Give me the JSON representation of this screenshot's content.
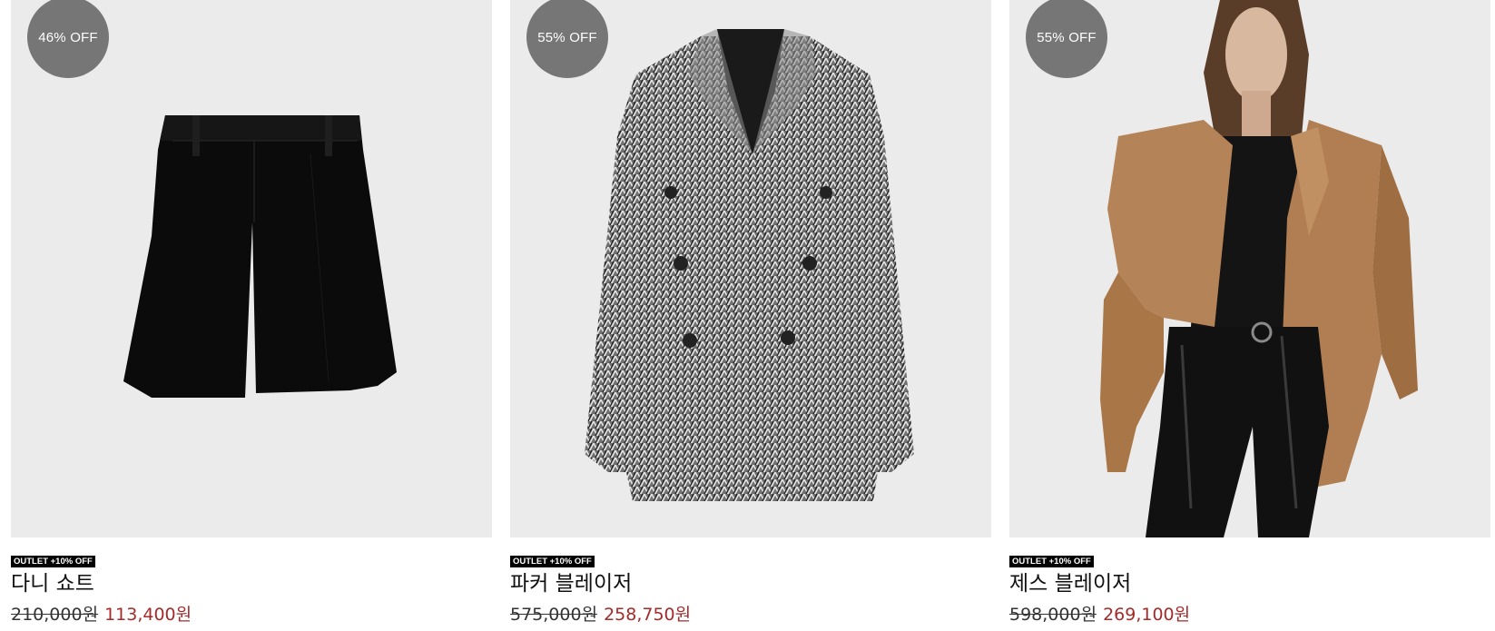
{
  "products": [
    {
      "badge": "46% OFF",
      "tag": "OUTLET +10% OFF",
      "name": "다니 쇼트",
      "original_price": "210,000원",
      "sale_price": "113,400원",
      "image": "black-shorts-icon"
    },
    {
      "badge": "55% OFF",
      "tag": "OUTLET +10% OFF",
      "name": "파커 블레이저",
      "original_price": "575,000원",
      "sale_price": "258,750원",
      "image": "herringbone-blazer-icon"
    },
    {
      "badge": "55% OFF",
      "tag": "OUTLET +10% OFF",
      "name": "제스 블레이저",
      "original_price": "598,000원",
      "sale_price": "269,100원",
      "image": "model-camel-blazer-icon"
    }
  ],
  "colors": {
    "badge_bg": "#767676",
    "tag_bg": "#000000",
    "sale_price": "#a52a2a",
    "image_bg": "#ebebeb"
  }
}
